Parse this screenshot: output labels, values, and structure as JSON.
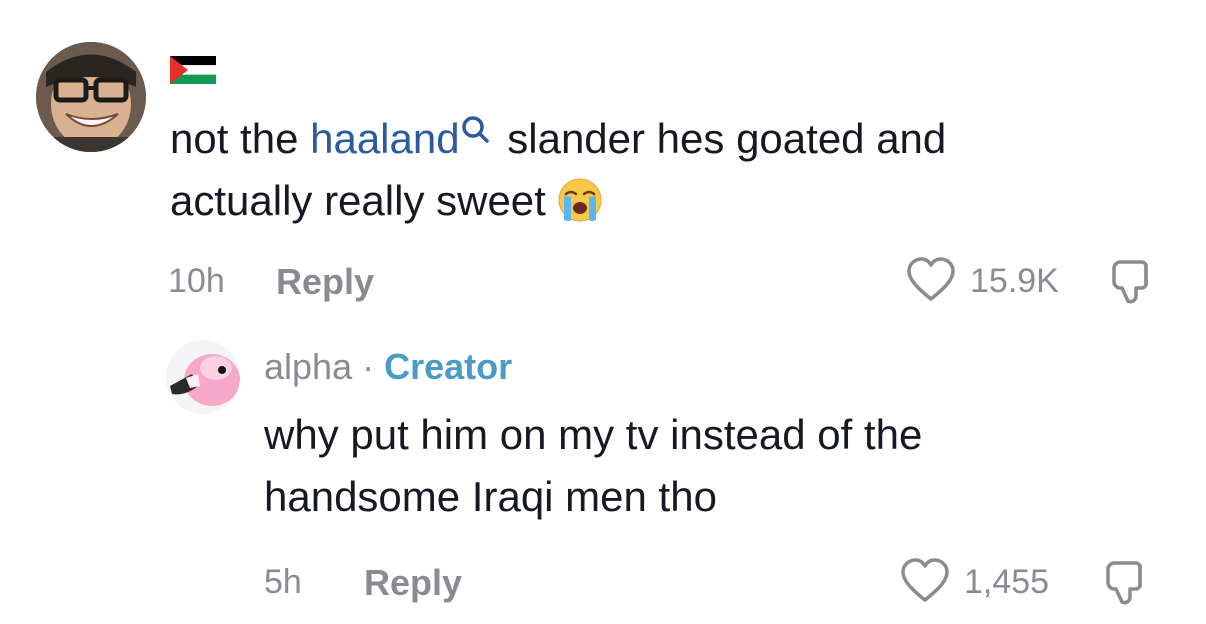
{
  "comments": [
    {
      "flag_icon": "palestine-flag-icon",
      "text_before": "not the ",
      "mention": "haaland",
      "mention_icon": "search-icon",
      "text_after_line1": " slander hes goated and",
      "text_line2": "actually really sweet",
      "emoji": "loudly-crying-face-icon",
      "time": "10h",
      "reply_label": "Reply",
      "like_count": "15.9K"
    },
    {
      "author": "alpha",
      "separator": " · ",
      "badge": "Creator",
      "text_line1": "why put him on my tv instead of the",
      "text_line2": "handsome Iraqi men tho",
      "time": "5h",
      "reply_label": "Reply",
      "like_count": "1,455"
    }
  ],
  "colors": {
    "text": "#161823",
    "muted": "#8a8b91",
    "mention": "#2b5a9e",
    "creator": "#4a9cc5"
  }
}
